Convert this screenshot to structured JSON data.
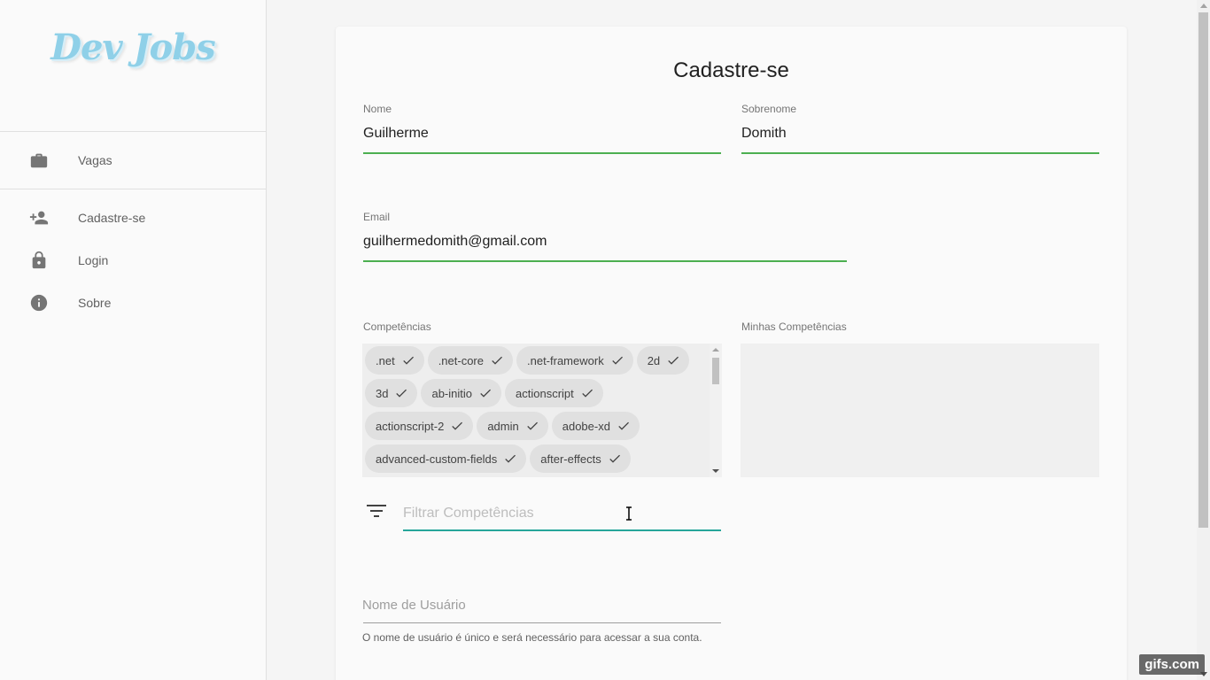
{
  "app": {
    "logo_text": "Dev Jobs",
    "accent_color": "#4caf50",
    "focus_color": "#26a69a"
  },
  "sidebar": {
    "items": [
      {
        "label": "Vagas",
        "icon": "briefcase-icon"
      },
      {
        "label": "Cadastre-se",
        "icon": "person-add-icon"
      },
      {
        "label": "Login",
        "icon": "lock-icon"
      },
      {
        "label": "Sobre",
        "icon": "info-icon"
      }
    ]
  },
  "form": {
    "title": "Cadastre-se",
    "first_name": {
      "label": "Nome",
      "value": "Guilherme"
    },
    "last_name": {
      "label": "Sobrenome",
      "value": "Domith"
    },
    "email": {
      "label": "Email",
      "value": "guilhermedomith@gmail.com"
    },
    "skills": {
      "label": "Competências",
      "chips": [
        ".net",
        ".net-core",
        ".net-framework",
        "2d",
        "3d",
        "ab-initio",
        "actionscript",
        "actionscript-2",
        "admin",
        "adobe-xd",
        "advanced-custom-fields",
        "after-effects"
      ]
    },
    "my_skills": {
      "label": "Minhas Competências"
    },
    "filter": {
      "placeholder": "Filtrar Competências",
      "icon": "filter-icon"
    },
    "username": {
      "placeholder": "Nome de Usuário",
      "helper": "O nome de usuário é único e será necessário para acessar a sua conta."
    }
  },
  "watermark": "gifs.com"
}
